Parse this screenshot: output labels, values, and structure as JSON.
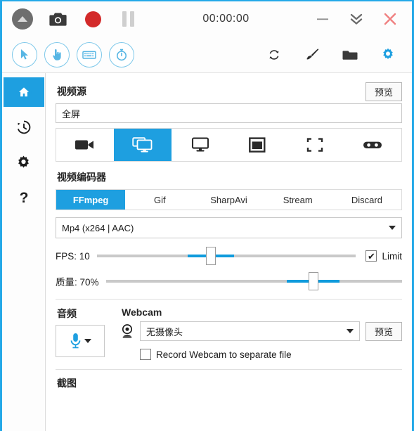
{
  "titlebar": {
    "timer": "00:00:00",
    "icons": [
      {
        "name": "expand-up-icon",
        "label": "Expand"
      },
      {
        "name": "camera-icon",
        "label": "Screenshot"
      },
      {
        "name": "record-icon",
        "label": "Record"
      },
      {
        "name": "pause-icon",
        "label": "Pause"
      }
    ],
    "window_controls": [
      {
        "name": "minimize-button",
        "label": "Minimize"
      },
      {
        "name": "collapse-button",
        "label": "Collapse"
      },
      {
        "name": "close-button",
        "label": "Close"
      }
    ]
  },
  "toolbar": {
    "left": [
      {
        "name": "cursor-icon",
        "label": "Include Cursor"
      },
      {
        "name": "click-hand-icon",
        "label": "Include Clicks"
      },
      {
        "name": "keyboard-icon",
        "label": "Include Keystrokes"
      },
      {
        "name": "timer-icon",
        "label": "Elapsed Timer"
      }
    ],
    "right": [
      {
        "name": "refresh-icon",
        "label": "Refresh"
      },
      {
        "name": "brush-icon",
        "label": "Image Editor"
      },
      {
        "name": "folder-icon",
        "label": "Open Output Folder"
      },
      {
        "name": "gear-icon",
        "label": "Settings"
      }
    ]
  },
  "sidebar": {
    "items": [
      {
        "name": "sidebar-item-home",
        "label": "Main",
        "active": true
      },
      {
        "name": "sidebar-item-history",
        "label": "Recent",
        "active": false
      },
      {
        "name": "sidebar-item-settings",
        "label": "Configure",
        "active": false
      },
      {
        "name": "sidebar-item-help",
        "label": "About",
        "active": false
      }
    ]
  },
  "video_source": {
    "title": "视频源",
    "preview_label": "预览",
    "value": "全屏",
    "types": [
      {
        "name": "source-video-device",
        "label": "Video Device",
        "active": false
      },
      {
        "name": "source-screen",
        "label": "Screen",
        "active": true
      },
      {
        "name": "source-desktop",
        "label": "Desktop Duplication",
        "active": false
      },
      {
        "name": "source-window",
        "label": "Window",
        "active": false
      },
      {
        "name": "source-region",
        "label": "Region",
        "active": false
      },
      {
        "name": "source-game",
        "label": "Game",
        "active": false
      }
    ]
  },
  "video_encoder": {
    "title": "视频编码器",
    "tabs": [
      {
        "label": "FFmpeg",
        "active": true
      },
      {
        "label": "Gif",
        "active": false
      },
      {
        "label": "SharpAvi",
        "active": false
      },
      {
        "label": "Stream",
        "active": false
      },
      {
        "label": "Discard",
        "active": false
      }
    ],
    "codec": "Mp4 (x264 | AAC)",
    "fps": {
      "label": "FPS: 10",
      "value": 10,
      "percent": 44,
      "limit_label": "Limit",
      "limit_checked": true,
      "check_glyph": "✔"
    },
    "quality": {
      "label": "质量: 70%",
      "value": 70,
      "percent": 70
    }
  },
  "audio": {
    "title": "音频",
    "device_icon": "microphone-icon"
  },
  "webcam": {
    "title": "Webcam",
    "value": "无摄像头",
    "preview_label": "预览",
    "separate_file_label": "Record Webcam to separate file",
    "separate_file_checked": false
  },
  "screenshot_section": {
    "title": "截图"
  },
  "colors": {
    "accent": "#1e9fe0",
    "border_blue": "#25a9e8",
    "slider_blue": "#0f9bdc",
    "record_red": "#d32a2a",
    "close_red": "#f08080"
  }
}
